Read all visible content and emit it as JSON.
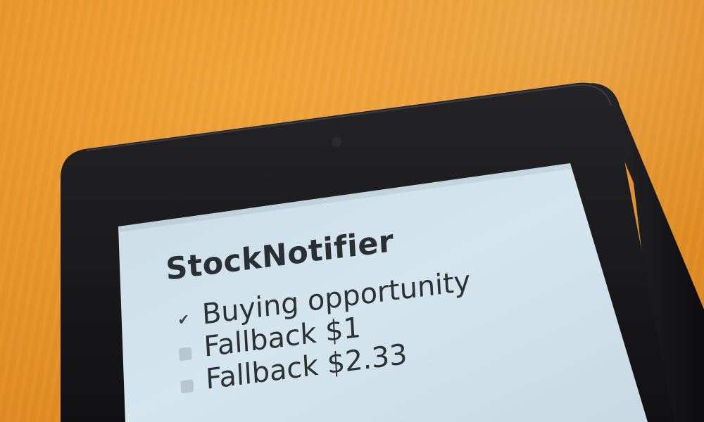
{
  "app": {
    "title": "StockNotifier"
  },
  "notifications": [
    {
      "label": "Buying opportunity",
      "checked": true
    },
    {
      "label": "Fallback $1",
      "checked": false
    },
    {
      "label": "Fallback $2.33",
      "checked": false
    }
  ],
  "colors": {
    "table_surface": "#e8952a",
    "device_bezel": "#1a1a1c",
    "screen_background": "#cfe0ea",
    "text": "#2c3134"
  },
  "icons": {
    "checked": "check-icon",
    "unchecked": "empty-checkbox-icon"
  }
}
